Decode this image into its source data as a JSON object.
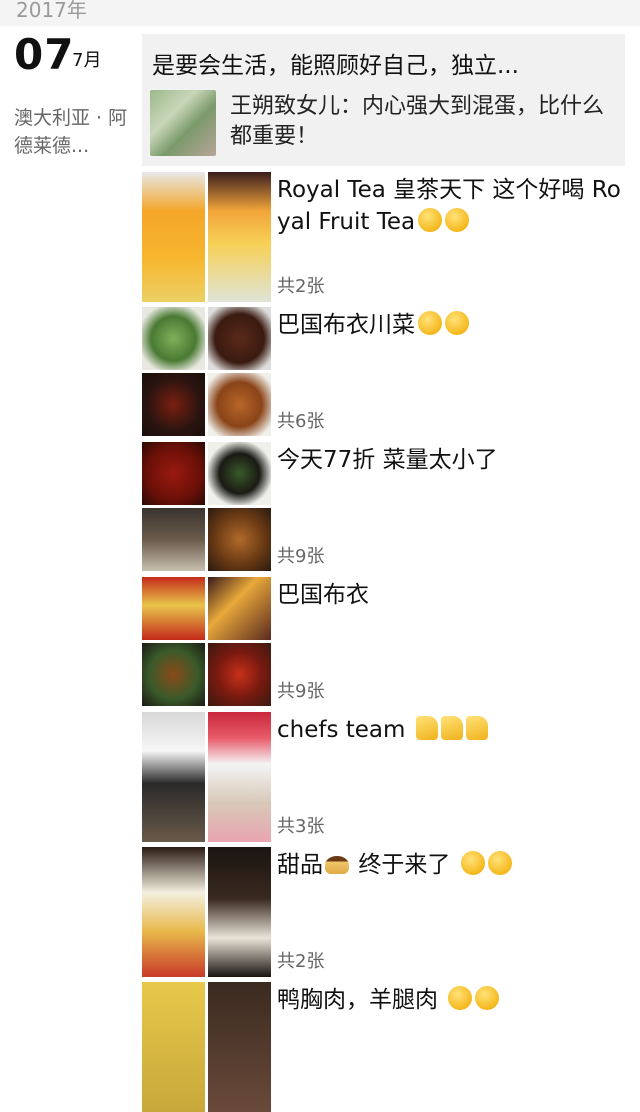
{
  "header": {
    "year": "2017年"
  },
  "date": {
    "day": "07",
    "month": "7月"
  },
  "location": "澳大利亚 · 阿德莱德...",
  "shared_article": {
    "title": "是要会生活，能照顾好自己，独立...",
    "text": "王朔致女儿：内心强大到混蛋，比什么都重要！"
  },
  "posts": [
    {
      "text": "Royal Tea 皇茶天下  这个好喝 Royal Fruit Tea",
      "emoji": [
        "hug-emoji",
        "hug-emoji"
      ],
      "count": "共2张"
    },
    {
      "text": "巴国布衣川菜",
      "emoji": [
        "smirk-emoji",
        "grin-emoji"
      ],
      "count": "共6张"
    },
    {
      "text": "今天77折  菜量太小了",
      "emoji": [],
      "count": "共9张"
    },
    {
      "text": "巴国布衣",
      "emoji": [],
      "count": "共9张"
    },
    {
      "text": "chefs team",
      "emoji": [
        "thumbs-up-emoji",
        "thumbs-up-emoji",
        "thumbs-up-emoji"
      ],
      "count": "共3张"
    },
    {
      "text_a": "甜品",
      "text_b": "终于来了",
      "emoji": [
        "pudding-emoji",
        "hug-emoji",
        "hug-emoji"
      ],
      "count": "共2张"
    },
    {
      "text": "鸭胸肉，羊腿肉",
      "emoji": [
        "heart-eyes-emoji",
        "heart-eyes-emoji"
      ]
    }
  ]
}
